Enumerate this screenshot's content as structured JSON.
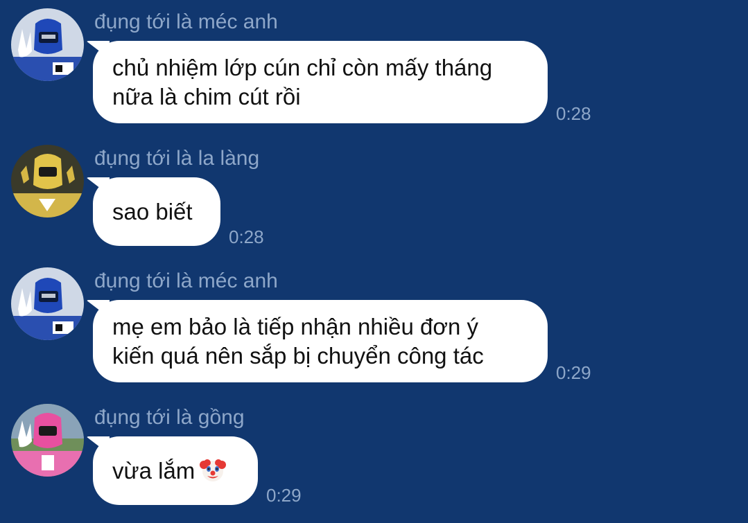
{
  "messages": [
    {
      "sender": "đụng tới là méc anh",
      "avatar": "blue-ranger-avatar",
      "text": "chủ nhiệm lớp cún chỉ còn mấy tháng\nnữa là chim cút rồi",
      "time": "0:28"
    },
    {
      "sender": "đụng tới là la làng",
      "avatar": "yellow-ranger-avatar",
      "text": "sao biết",
      "time": "0:28"
    },
    {
      "sender": "đụng tới là méc anh",
      "avatar": "blue-ranger-avatar",
      "text": "mẹ em bảo là tiếp nhận nhiều đơn ý\nkiến quá nên sắp bị chuyển công tác",
      "time": "0:29"
    },
    {
      "sender": "đụng tới là gồng",
      "avatar": "pink-ranger-avatar",
      "text": "vừa lắm",
      "emoji": "clown-face-icon",
      "time": "0:29"
    }
  ],
  "colors": {
    "background": "#11376f",
    "bubble": "#ffffff",
    "meta_text": "#8ea7c9",
    "message_text": "#111111"
  }
}
